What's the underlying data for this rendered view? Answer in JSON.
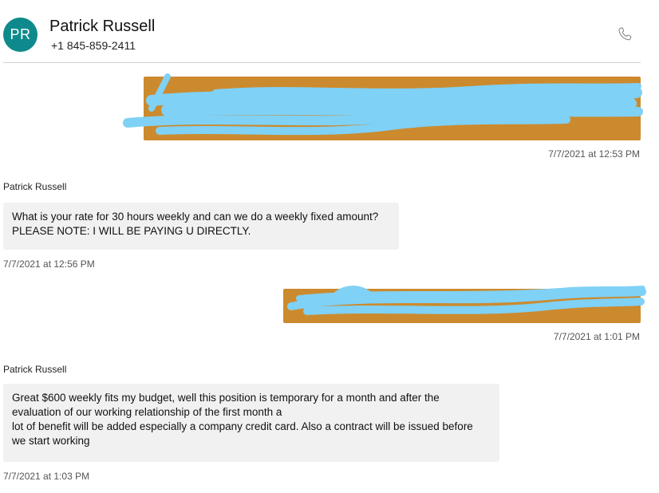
{
  "contact": {
    "initials": "PR",
    "name": "Patrick Russell",
    "phone": "+1 845-859-2411",
    "avatar_color": "#0e8a8c"
  },
  "icons": {
    "call": "phone-icon"
  },
  "colors": {
    "outgoing_bubble": "#cc8a2e",
    "redaction_scribble": "#7fd1f5",
    "incoming_bubble": "#f1f1f1"
  },
  "messages": [
    {
      "direction": "outgoing",
      "redacted": true,
      "timestamp": "7/7/2021 at 12:53 PM"
    },
    {
      "direction": "incoming",
      "sender": "Patrick Russell",
      "lines": [
        "What is your rate for 30 hours weekly and can we do a weekly fixed amount?",
        "PLEASE NOTE: I WILL BE PAYING U DIRECTLY."
      ],
      "timestamp": "7/7/2021 at 12:56 PM"
    },
    {
      "direction": "outgoing",
      "redacted": true,
      "timestamp": "7/7/2021 at 1:01 PM"
    },
    {
      "direction": "incoming",
      "sender": "Patrick Russell",
      "lines": [
        "Great $600 weekly fits my budget, well this position is temporary for a month and after the",
        "evaluation of our working relationship of the first month a",
        "lot of benefit will be added especially a company credit card. Also a contract will be issued before",
        "we start working"
      ],
      "timestamp": "7/7/2021 at 1:03 PM"
    }
  ]
}
